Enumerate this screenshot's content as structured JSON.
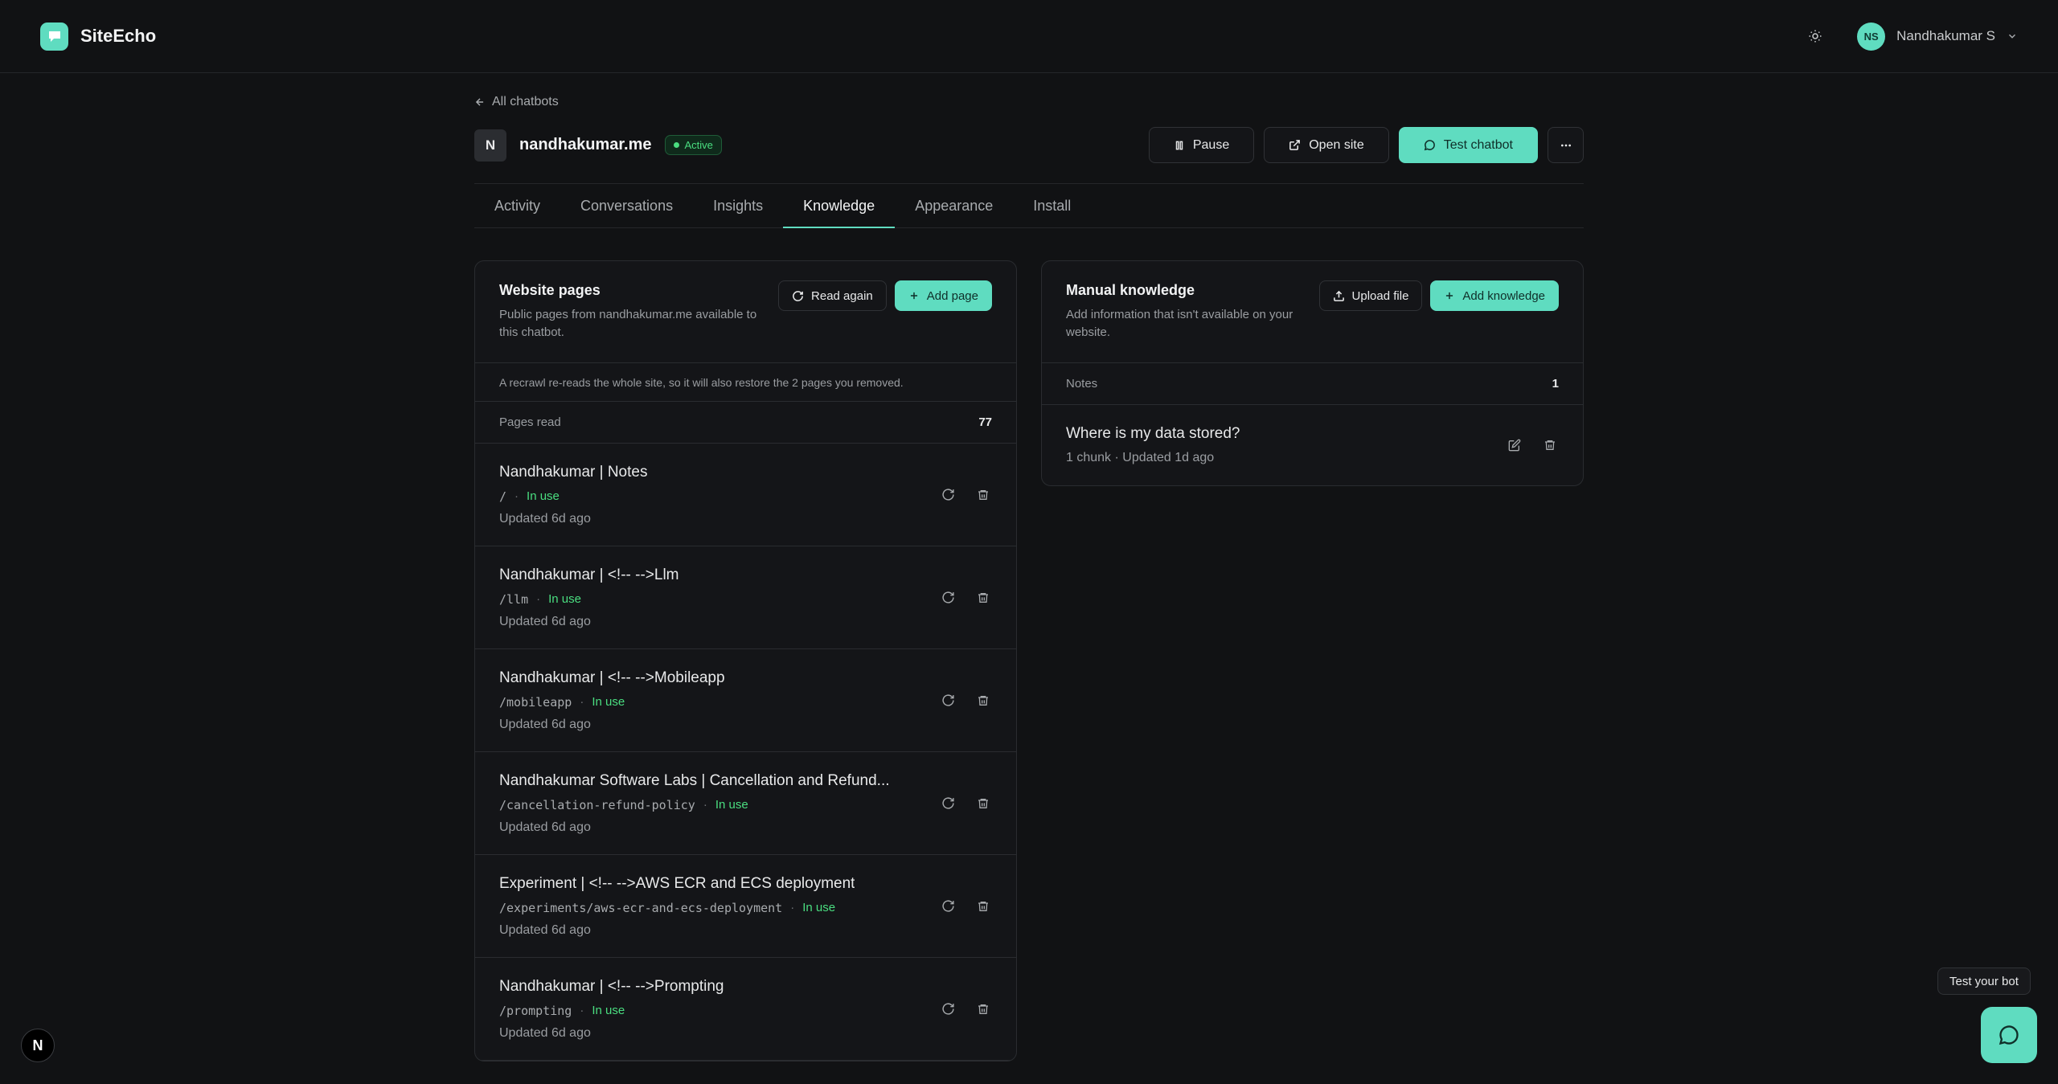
{
  "app": {
    "name": "SiteEcho"
  },
  "user": {
    "initials": "NS",
    "name": "Nandhakumar S"
  },
  "nav": {
    "back_label": "All chatbots"
  },
  "bot": {
    "initial": "N",
    "name": "nandhakumar.me",
    "status": "Active",
    "actions": {
      "pause": "Pause",
      "open_site": "Open site",
      "test": "Test chatbot"
    }
  },
  "tabs": [
    "Activity",
    "Conversations",
    "Insights",
    "Knowledge",
    "Appearance",
    "Install"
  ],
  "active_tab": "Knowledge",
  "website": {
    "title": "Website pages",
    "desc": "Public pages from nandhakumar.me available to this chatbot.",
    "read_again": "Read again",
    "add_page": "Add page",
    "note": "A recrawl re-reads the whole site, so it will also restore the 2 pages you removed.",
    "count_label": "Pages read",
    "count": "77",
    "pages": [
      {
        "title": "Nandhakumar | Notes",
        "path": "/",
        "status": "In use",
        "updated": "Updated 6d ago"
      },
      {
        "title": "Nandhakumar | <!-- -->Llm",
        "path": "/llm",
        "status": "In use",
        "updated": "Updated 6d ago"
      },
      {
        "title": "Nandhakumar | <!-- -->Mobileapp",
        "path": "/mobileapp",
        "status": "In use",
        "updated": "Updated 6d ago"
      },
      {
        "title": "Nandhakumar Software Labs | Cancellation and Refund...",
        "path": "/cancellation-refund-policy",
        "status": "In use",
        "updated": "Updated 6d ago"
      },
      {
        "title": "Experiment | <!-- -->AWS ECR and ECS deployment",
        "path": "/experiments/aws-ecr-and-ecs-deployment",
        "status": "In use",
        "updated": "Updated 6d ago"
      },
      {
        "title": "Nandhakumar | <!-- -->Prompting",
        "path": "/prompting",
        "status": "In use",
        "updated": "Updated 6d ago"
      }
    ]
  },
  "manual": {
    "title": "Manual knowledge",
    "desc": "Add information that isn't available on your website.",
    "upload": "Upload file",
    "add": "Add knowledge",
    "notes_label": "Notes",
    "notes_count": "1",
    "items": [
      {
        "title": "Where is my data stored?",
        "meta": "1 chunk · Updated 1d ago"
      }
    ]
  },
  "widget": {
    "tooltip": "Test your bot"
  },
  "dev_badge": "N",
  "colors": {
    "accent": "#5fdcc0",
    "success": "#4ade80",
    "background": "#111214"
  }
}
